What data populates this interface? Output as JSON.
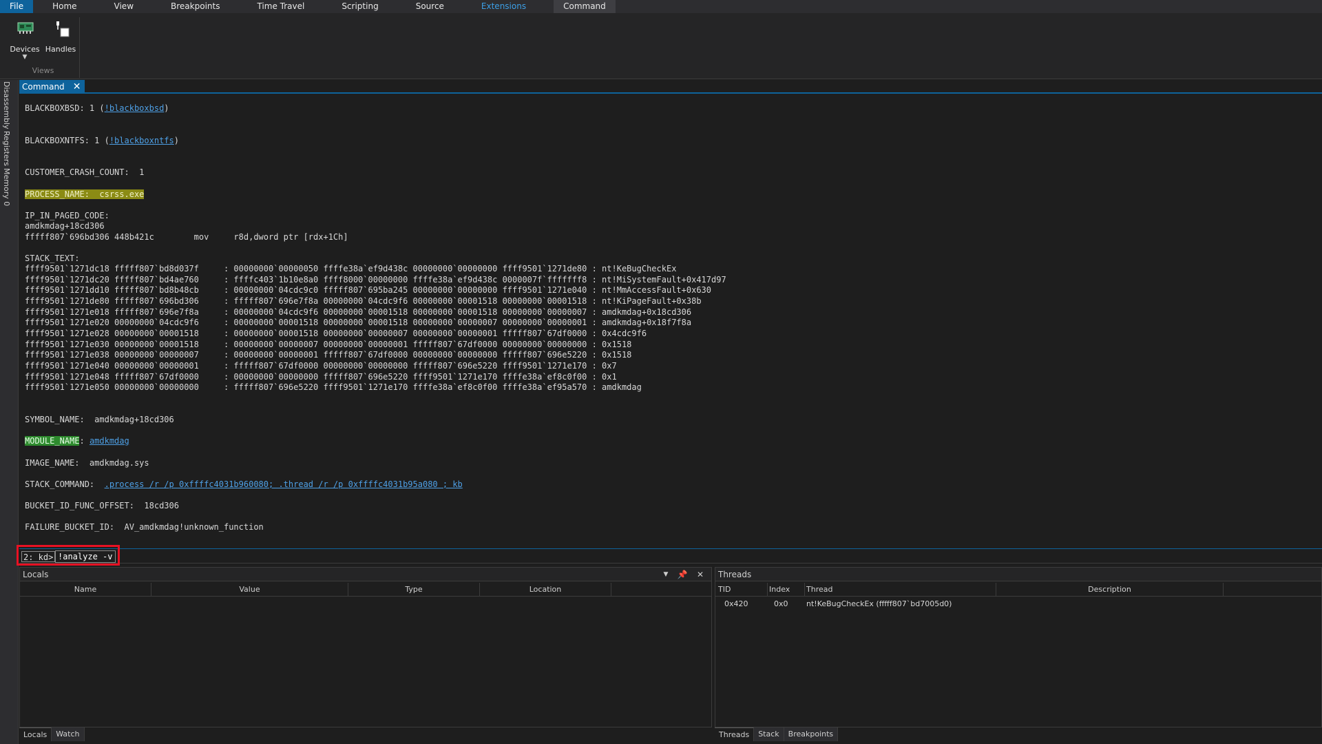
{
  "menu": {
    "items": [
      "File",
      "Home",
      "View",
      "Breakpoints",
      "Time Travel",
      "Scripting",
      "Source",
      "Extensions",
      "Command"
    ],
    "active_color": "#3c9fe6"
  },
  "ribbon": {
    "devices_label": "Devices",
    "handles_label": "Handles",
    "group_label": "Views"
  },
  "left_tabs": [
    "Disassembly",
    "Registers",
    "Memory 0"
  ],
  "command_tab": {
    "label": "Command"
  },
  "output": {
    "blackboxbsd_prefix": "BLACKBOXBSD: 1 (",
    "blackboxbsd_link": "!blackboxbsd",
    "blackboxntfs_prefix": "BLACKBOXNTFS: 1 (",
    "blackboxntfs_link": "!blackboxntfs",
    "close_paren": ")",
    "customer_crash_count": "CUSTOMER_CRASH_COUNT:  1",
    "process_name": "PROCESS_NAME:  csrss.exe",
    "ip_in_paged_code": "IP_IN_PAGED_CODE:",
    "ip_symbol": "amdkmdag+18cd306",
    "ip_instruction": "fffff807`696bd306 448b421c        mov     r8d,dword ptr [rdx+1Ch]",
    "stack_text_label": "STACK_TEXT:",
    "stack_lines": [
      "ffff9501`1271dc18 fffff807`bd8d037f     : 00000000`00000050 ffffe38a`ef9d438c 00000000`00000000 ffff9501`1271de80 : nt!KeBugCheckEx",
      "ffff9501`1271dc20 fffff807`bd4ae760     : ffffc403`1b10e8a0 ffff8000`00000000 ffffe38a`ef9d438c 0000007f`fffffff8 : nt!MiSystemFault+0x417d97",
      "ffff9501`1271dd10 fffff807`bd8b48cb     : 00000000`04cdc9c0 fffff807`695ba245 00000000`00000000 ffff9501`1271e040 : nt!MmAccessFault+0x630",
      "ffff9501`1271de80 fffff807`696bd306     : fffff807`696e7f8a 00000000`04cdc9f6 00000000`00001518 00000000`00001518 : nt!KiPageFault+0x38b",
      "ffff9501`1271e018 fffff807`696e7f8a     : 00000000`04cdc9f6 00000000`00001518 00000000`00001518 00000000`00000007 : amdkmdag+0x18cd306",
      "ffff9501`1271e020 00000000`04cdc9f6     : 00000000`00001518 00000000`00001518 00000000`00000007 00000000`00000001 : amdkmdag+0x18f7f8a",
      "ffff9501`1271e028 00000000`00001518     : 00000000`00001518 00000000`00000007 00000000`00000001 fffff807`67df0000 : 0x4cdc9f6",
      "ffff9501`1271e030 00000000`00001518     : 00000000`00000007 00000000`00000001 fffff807`67df0000 00000000`00000000 : 0x1518",
      "ffff9501`1271e038 00000000`00000007     : 00000000`00000001 fffff807`67df0000 00000000`00000000 fffff807`696e5220 : 0x1518",
      "ffff9501`1271e040 00000000`00000001     : fffff807`67df0000 00000000`00000000 fffff807`696e5220 ffff9501`1271e170 : 0x7",
      "ffff9501`1271e048 fffff807`67df0000     : 00000000`00000000 fffff807`696e5220 ffff9501`1271e170 ffffe38a`ef8c0f00 : 0x1",
      "ffff9501`1271e050 00000000`00000000     : fffff807`696e5220 ffff9501`1271e170 ffffe38a`ef8c0f00 ffffe38a`ef95a570 : amdkmdag"
    ],
    "symbol_name": "SYMBOL_NAME:  amdkmdag+18cd306",
    "module_name_label": "MODULE_NAME",
    "module_name_sep": ": ",
    "module_name_link": "amdkmdag",
    "image_name": "IMAGE_NAME:  amdkmdag.sys",
    "stack_command_label": "STACK_COMMAND:  ",
    "stack_command_link": ".process /r /p 0xffffc4031b960080; .thread /r /p 0xffffc4031b95a080 ; kb",
    "bucket_offset": "BUCKET_ID_FUNC_OFFSET:  18cd306",
    "failure_bucket": "FAILURE_BUCKET_ID:  AV_amdkmdag!unknown_function"
  },
  "command_line": {
    "prompt": "2: kd>",
    "value": "!analyze -v"
  },
  "locals_panel": {
    "title": "Locals",
    "columns": [
      "Name",
      "Value",
      "Type",
      "Location"
    ],
    "tabs": [
      "Locals",
      "Watch"
    ]
  },
  "threads_panel": {
    "title": "Threads",
    "columns": [
      "TID",
      "Index",
      "Thread",
      "Description"
    ],
    "rows": [
      {
        "tid": "0x420",
        "index": "0x0",
        "thread": "nt!KeBugCheckEx (fffff807`bd7005d0)",
        "description": ""
      }
    ],
    "tabs": [
      "Threads",
      "Stack",
      "Breakpoints"
    ]
  },
  "colors": {
    "accent": "#0e639c",
    "highlight_yellow": "#8b8b14",
    "highlight_green": "#2e8b2e",
    "annotation_red": "#e81123"
  }
}
